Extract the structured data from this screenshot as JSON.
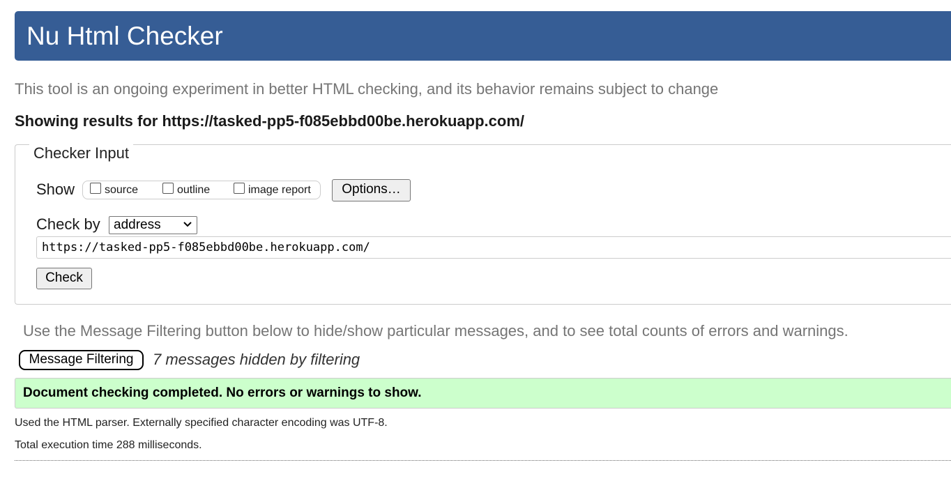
{
  "header": {
    "title": "Nu Html Checker",
    "background_color": "#365d95"
  },
  "intro": {
    "subtitle": "This tool is an ongoing experiment in better HTML checking, and its behavior remains subject to change",
    "results_for": "Showing results for https://tasked-pp5-f085ebbd00be.herokuapp.com/"
  },
  "checker_input": {
    "legend": "Checker Input",
    "show_label": "Show",
    "checkboxes": [
      {
        "label": "source",
        "checked": false
      },
      {
        "label": "outline",
        "checked": false
      },
      {
        "label": "image report",
        "checked": false
      }
    ],
    "options_button": "Options…",
    "check_by_label": "Check by",
    "check_by_selected": "address",
    "url_value": "https://tasked-pp5-f085ebbd00be.herokuapp.com/",
    "check_button": "Check"
  },
  "filtering": {
    "info": "Use the Message Filtering button below to hide/show particular messages, and to see total counts of errors and warnings.",
    "button": "Message Filtering",
    "hidden_count_text": "7 messages hidden by filtering"
  },
  "result": {
    "success_message": "Document checking completed. No errors or warnings to show.",
    "success_color": "#ccffcc",
    "parser_info": "Used the HTML parser. Externally specified character encoding was UTF-8.",
    "execution_time": "Total execution time 288 milliseconds."
  }
}
